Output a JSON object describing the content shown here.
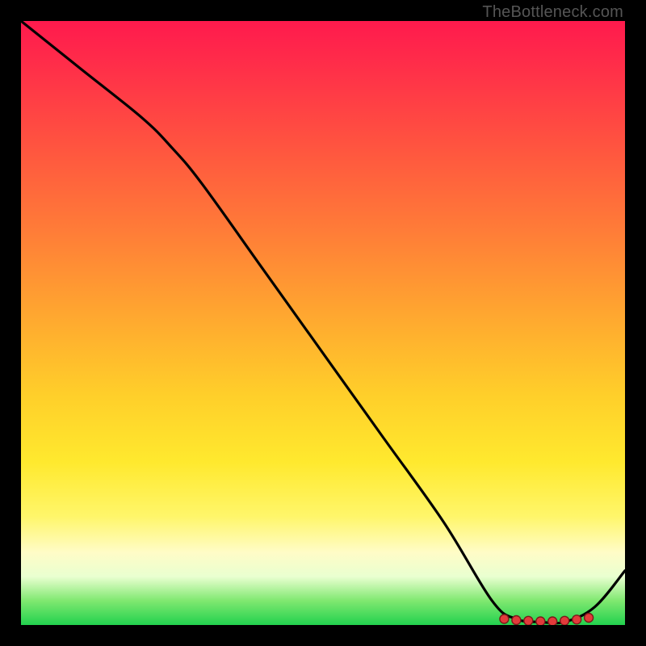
{
  "credit": "TheBottleneck.com",
  "colors": {
    "frame": "#000000",
    "line": "#000000",
    "dot_fill": "#e23b3b",
    "dot_stroke": "#7a1a1a",
    "gradient_top": "#ff1a4d",
    "gradient_bottom": "#22d14e"
  },
  "chart_data": {
    "type": "line",
    "title": "",
    "xlabel": "",
    "ylabel": "",
    "xlim": [
      0,
      100
    ],
    "ylim": [
      0,
      100
    ],
    "grid": false,
    "legend": false,
    "series": [
      {
        "name": "curve",
        "x": [
          0,
          10,
          20,
          25,
          30,
          40,
          50,
          60,
          70,
          78,
          82,
          86,
          90,
          95,
          100
        ],
        "values": [
          100,
          92,
          84,
          79,
          73,
          59,
          45,
          31,
          17,
          4,
          1,
          0.5,
          0.5,
          3,
          9
        ]
      }
    ],
    "markers": {
      "name": "low-band-dots",
      "x": [
        80,
        82,
        84,
        86,
        88,
        90,
        92,
        94
      ],
      "values": [
        1.0,
        0.8,
        0.7,
        0.6,
        0.6,
        0.7,
        0.9,
        1.2
      ]
    }
  }
}
